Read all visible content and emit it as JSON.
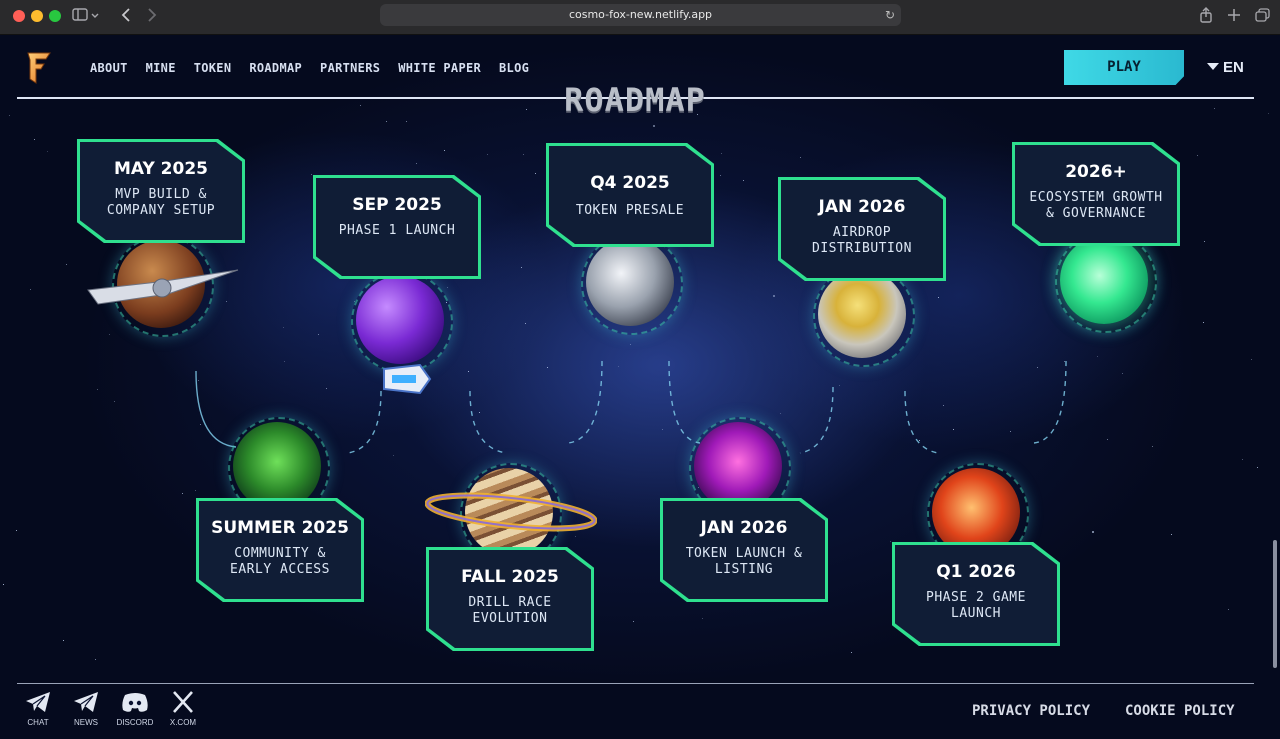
{
  "browser": {
    "url": "cosmo-fox-new.netlify.app"
  },
  "nav": {
    "items": [
      "ABOUT",
      "MINE",
      "TOKEN",
      "ROADMAP",
      "PARTNERS",
      "WHITE PAPER",
      "BLOG"
    ],
    "play_label": "PLAY",
    "language": "EN"
  },
  "section_title": "ROADMAP",
  "milestones": [
    {
      "date": "MAY 2025",
      "desc": "MVP BUILD &\nCOMPANY SETUP"
    },
    {
      "date": "SEP 2025",
      "desc": "PHASE 1 LAUNCH"
    },
    {
      "date": "Q4 2025",
      "desc": "TOKEN PRESALE"
    },
    {
      "date": "JAN 2026",
      "desc": "AIRDROP\nDISTRIBUTION"
    },
    {
      "date": "2026+",
      "desc": "ECOSYSTEM GROWTH\n& GOVERNANCE"
    },
    {
      "date": "SUMMER 2025",
      "desc": "COMMUNITY &\nEARLY ACCESS"
    },
    {
      "date": "FALL 2025",
      "desc": "DRILL RACE\nEVOLUTION"
    },
    {
      "date": "JAN 2026",
      "desc": "TOKEN LAUNCH &\nLISTING"
    },
    {
      "date": "Q1 2026",
      "desc": "PHASE 2 GAME\nLAUNCH"
    }
  ],
  "footer": {
    "social": [
      "CHAT",
      "NEWS",
      "DISCORD",
      "X.COM"
    ],
    "links": [
      "PRIVACY POLICY",
      "COOKIE POLICY"
    ]
  },
  "colors": {
    "accent": "#2fe08f",
    "play_button": "#3fd9e6",
    "card_bg": "#101d36",
    "page_bg": "#05081a"
  },
  "icons": [
    "sidebar-icon",
    "back-icon",
    "forward-icon",
    "reload-icon",
    "share-icon",
    "new-tab-icon",
    "tabs-icon",
    "telegram-icon",
    "discord-icon",
    "x-icon"
  ]
}
